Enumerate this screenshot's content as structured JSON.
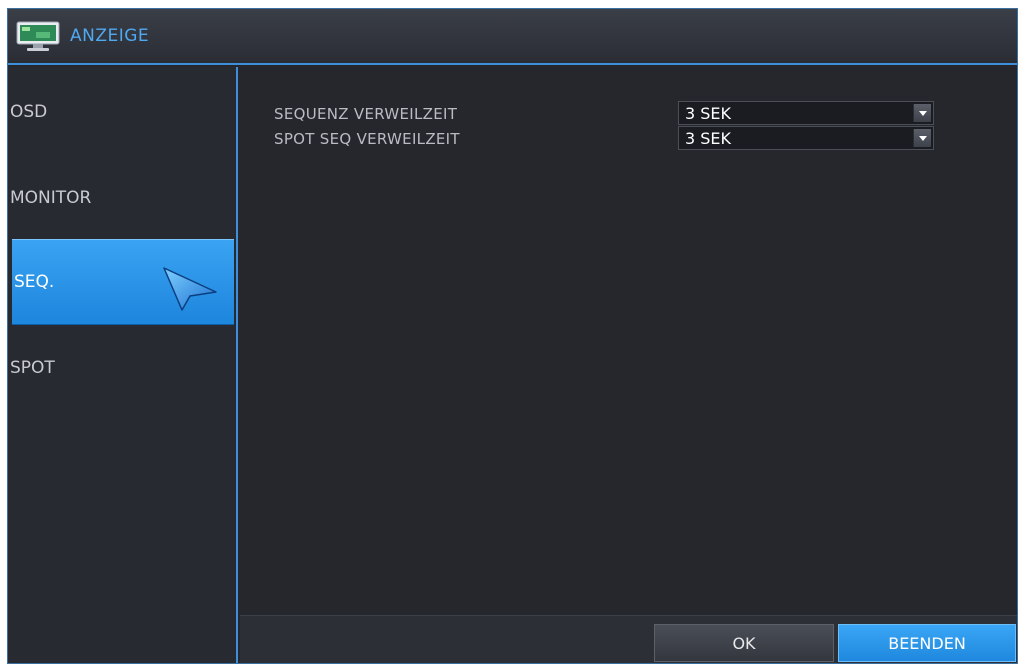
{
  "window": {
    "title": "ANZEIGE",
    "title_icon": "monitor-icon"
  },
  "sidebar": {
    "items": [
      {
        "label": "OSD",
        "active": false
      },
      {
        "label": "MONITOR",
        "active": false
      },
      {
        "label": "SEQ.",
        "active": true
      },
      {
        "label": "SPOT",
        "active": false
      }
    ]
  },
  "content": {
    "rows": [
      {
        "label": "SEQUENZ VERWEILZEIT",
        "value": "3 SEK"
      },
      {
        "label": "SPOT SEQ VERWEILZEIT",
        "value": "3 SEK"
      }
    ]
  },
  "footer": {
    "ok_label": "OK",
    "exit_label": "BEENDEN"
  },
  "colors": {
    "accent": "#3d8fd9",
    "active_bg": "#2a95e8",
    "panel_bg": "#25272d"
  }
}
